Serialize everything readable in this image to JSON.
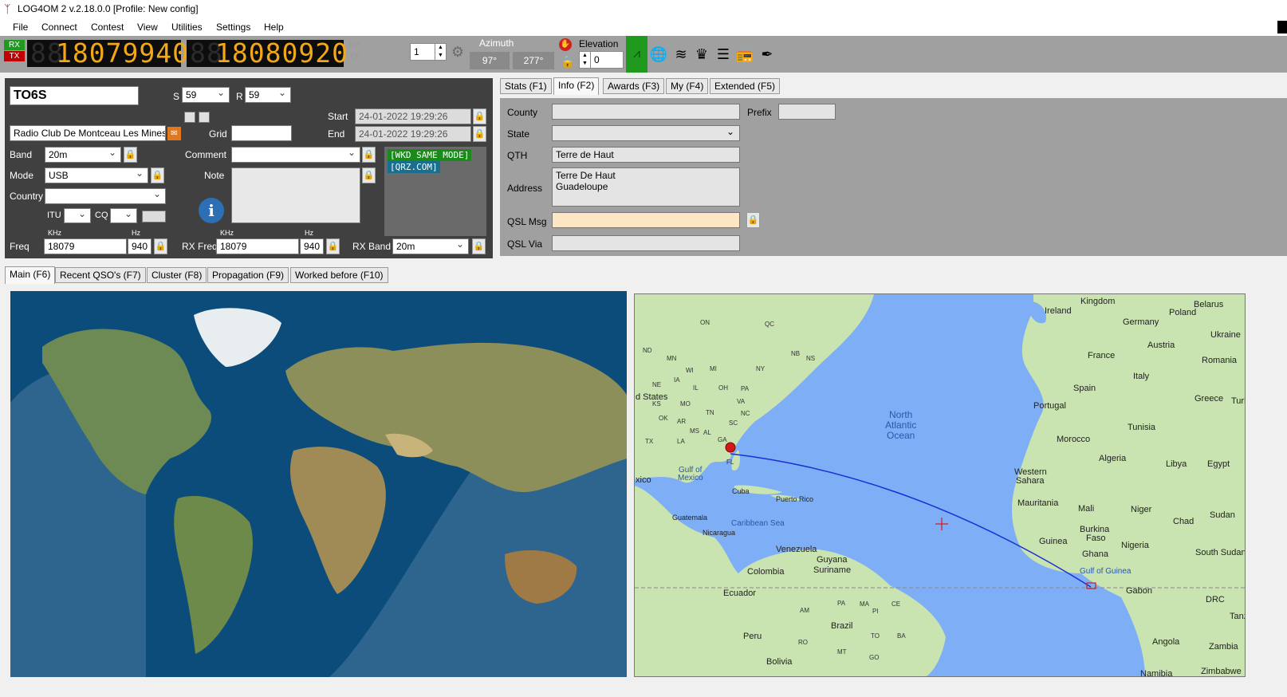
{
  "window": {
    "title": "LOG4OM 2 v.2.18.0.0 [Profile: New config]"
  },
  "menu": [
    "File",
    "Connect",
    "Contest",
    "View",
    "Utilities",
    "Settings",
    "Help"
  ],
  "radio": {
    "rx_label": "RX",
    "tx_label": "TX",
    "freq1": "18079940",
    "freq1_ghost": "88",
    "freq2": "18080920",
    "freq2_ghost": "88",
    "rx_dim": "RX",
    "tx_dim": "TX",
    "stepper_value": "1",
    "azimuth_label": "Azimuth",
    "azimuth_short": "97°",
    "azimuth_long": "277°",
    "elevation_label": "Elevation",
    "elevation_value": "0"
  },
  "qso": {
    "callsign": "TO6S",
    "s_label": "S",
    "s_value": "59",
    "r_label": "R",
    "r_value": "59",
    "name": "Radio Club De Montceau Les Mines F",
    "grid_label": "Grid",
    "grid_value": "",
    "start_label": "Start",
    "start_value": "24-01-2022 19:29:26",
    "end_label": "End",
    "end_value": "24-01-2022 19:29:26",
    "band_label": "Band",
    "band_value": "20m",
    "mode_label": "Mode",
    "mode_value": "USB",
    "country_label": "Country",
    "country_value": "",
    "comment_label": "Comment",
    "comment_value": "",
    "note_label": "Note",
    "note_value": "",
    "itu_label": "ITU",
    "cq_label": "CQ",
    "khz_label": "KHz",
    "hz_label": "Hz",
    "freq_label": "Freq",
    "freq_khz": "18079",
    "freq_hz": "940",
    "rxfreq_label": "RX Freq",
    "rxfreq_khz": "18079",
    "rxfreq_hz": "940",
    "rxband_label": "RX Band",
    "rxband_value": "20m",
    "wkd_same_mode": "[WKD SAME MODE]",
    "qrz_com": "[QRZ.COM]"
  },
  "info_tabs": [
    "Stats (F1)",
    "Info (F2)",
    "Awards (F3)",
    "My (F4)",
    "Extended (F5)"
  ],
  "info": {
    "county_label": "County",
    "county_value": "",
    "prefix_label": "Prefix",
    "prefix_value": "",
    "state_label": "State",
    "state_value": "",
    "qth_label": "QTH",
    "qth_value": "Terre de Haut",
    "address_label": "Address",
    "address_line1": "Terre De Haut",
    "address_line2": "Guadeloupe",
    "qslmsg_label": "QSL Msg",
    "qslmsg_value": "",
    "qslvia_label": "QSL Via",
    "qslvia_value": ""
  },
  "main_tabs": [
    "Main (F6)",
    "Recent QSO's (F7)",
    "Cluster (F8)",
    "Propagation (F9)",
    "Worked before (F10)"
  ],
  "map_labels": {
    "ireland": "Ireland",
    "kingdom": "Kingdom",
    "belarus": "Belarus",
    "germany": "Germany",
    "poland": "Poland",
    "ukraine": "Ukraine",
    "austria": "Austria",
    "france": "France",
    "romania": "Romania",
    "italy": "Italy",
    "spain": "Spain",
    "greece": "Greece",
    "turk": "Turk",
    "portugal": "Portugal",
    "tunisia": "Tunisia",
    "morocco": "Morocco",
    "algeria": "Algeria",
    "libya": "Libya",
    "egypt": "Egypt",
    "western_sahara_1": "Western",
    "western_sahara_2": "Sahara",
    "mauritania": "Mauritania",
    "mali": "Mali",
    "niger": "Niger",
    "chad": "Chad",
    "sudan": "Sudan",
    "burkina_1": "Burkina",
    "burkina_2": "Faso",
    "guinea": "Guinea",
    "ghana": "Ghana",
    "nigeria": "Nigeria",
    "south_sudan": "South Sudan",
    "gulf_guinea": "Gulf of Guinea",
    "gabon": "Gabon",
    "drc": "DRC",
    "tanz": "Tanz",
    "angola": "Angola",
    "zambia": "Zambia",
    "namibia": "Namibia",
    "zimbabwe": "Zimbabwe",
    "ocean_1": "North",
    "ocean_2": "Atlantic",
    "ocean_3": "Ocean",
    "states": "d States",
    "gulf_mexico_1": "Gulf of",
    "gulf_mexico_2": "Mexico",
    "xico": "xico",
    "cuba": "Cuba",
    "puerto_rico": "Puerto Rico",
    "guatemala": "Guatemala",
    "nicaragua": "Nicaragua",
    "caribbean": "Caribbean Sea",
    "venezuela": "Venezuela",
    "guyana": "Guyana",
    "suriname": "Suriname",
    "colombia": "Colombia",
    "ecuador": "Ecuador",
    "brazil": "Brazil",
    "peru": "Peru",
    "bolivia": "Bolivia",
    "on": "ON",
    "qc": "QC",
    "nd": "ND",
    "mn": "MN",
    "nb": "NB",
    "ns": "NS",
    "wi": "WI",
    "mi": "MI",
    "ny": "NY",
    "pa": "PA",
    "ia": "IA",
    "ne": "NE",
    "il": "IL",
    "oh": "OH",
    "va": "VA",
    "nc": "NC",
    "ks": "KS",
    "mo": "MO",
    "tn": "TN",
    "ok": "OK",
    "ar": "AR",
    "sc": "SC",
    "ms": "MS",
    "al": "AL",
    "ga": "GA",
    "tx": "TX",
    "la": "LA",
    "fl": "FL",
    "am": "AM",
    "pa2": "PA",
    "ma": "MA",
    "pi": "PI",
    "ce": "CE",
    "to": "TO",
    "ba": "BA",
    "ro": "RO",
    "mt": "MT",
    "go": "GO"
  },
  "colors": {
    "lcd": "#f2a818",
    "toolbar": "#a0a0a0",
    "panel": "#404040",
    "ocean": "#7eaef5",
    "land": "#c8e2b0"
  }
}
